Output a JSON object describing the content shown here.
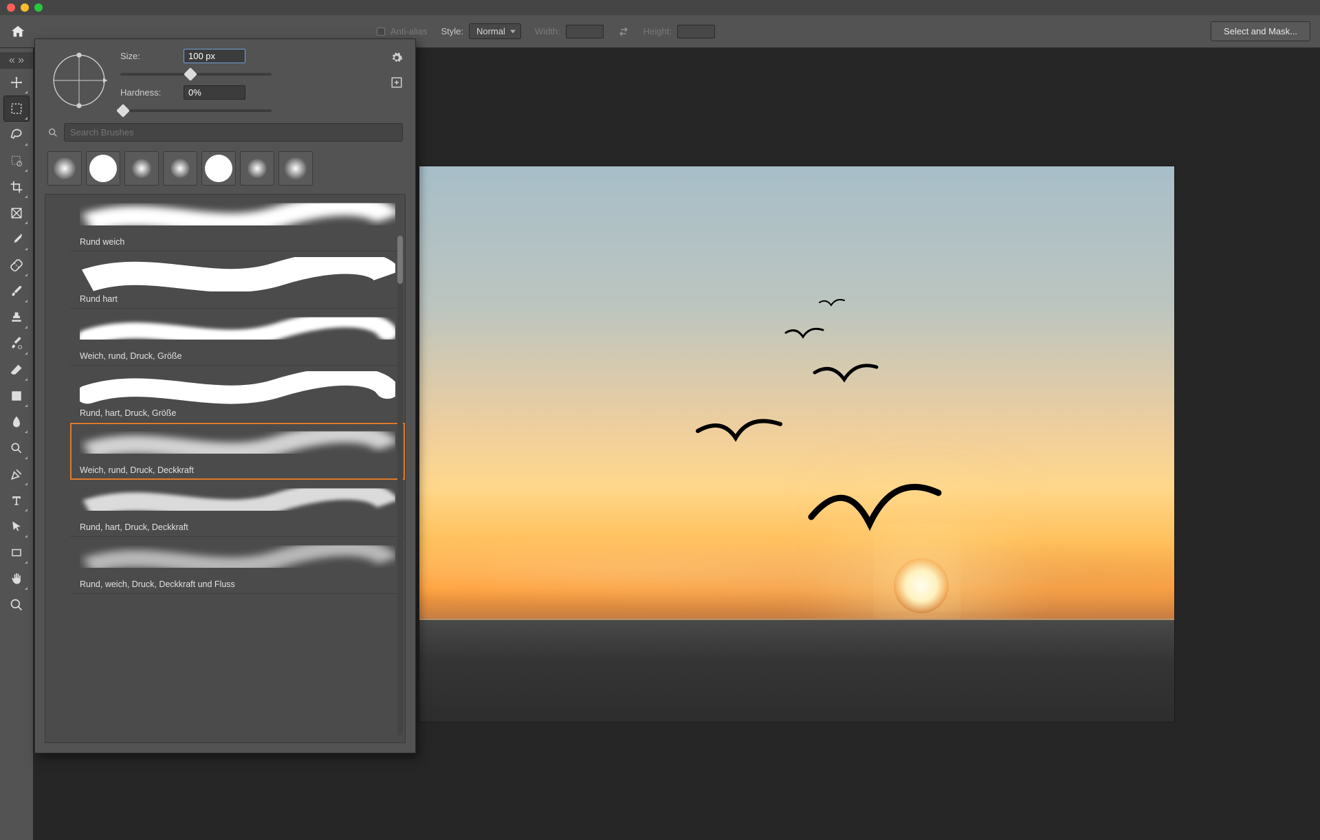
{
  "optionsbar": {
    "anti_alias": "Anti-alias",
    "style_label": "Style:",
    "style_value": "Normal",
    "width_label": "Width:",
    "width_value": "",
    "height_label": "Height:",
    "height_value": "",
    "select_mask": "Select and Mask..."
  },
  "brush_popup": {
    "size_label": "Size:",
    "size_value": "100 px",
    "hardness_label": "Hardness:",
    "hardness_value": "0%",
    "search_placeholder": "Search Brushes",
    "presets": [
      {
        "label": "Rund weich",
        "type": "soft"
      },
      {
        "label": "Rund hart",
        "type": "hard"
      },
      {
        "label": "Weich, rund, Druck, Größe",
        "type": "soft-taper"
      },
      {
        "label": "Rund, hart, Druck, Größe",
        "type": "hard-taper"
      },
      {
        "label": "Weich, rund, Druck, Deckkraft",
        "type": "soft-opacity",
        "selected": true
      },
      {
        "label": "Rund, hart, Druck, Deckkraft",
        "type": "hard-opacity"
      },
      {
        "label": "Rund, weich, Druck, Deckkraft und Fluss",
        "type": "soft-flow"
      }
    ]
  }
}
